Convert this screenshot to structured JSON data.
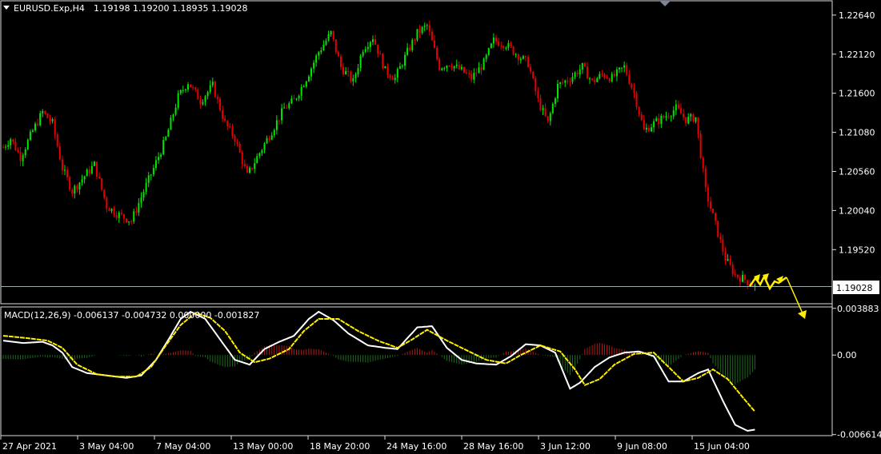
{
  "header": {
    "symbol": "EURUSD.Exp,H4",
    "ohlc": "1.19198 1.19200 1.18935 1.19028"
  },
  "macd_header": {
    "name": "MACD(12,26,9)",
    "values": "-0.006137 -0.004732 0.000000 -0.001827"
  },
  "price_scale": [
    "1.22640",
    "1.22120",
    "1.21600",
    "1.21080",
    "1.20560",
    "1.20040",
    "1.19520"
  ],
  "current_price": "1.19028",
  "macd_scale": [
    "0.003883",
    "0.00",
    "-0.006614"
  ],
  "time_axis": [
    "27 Apr 2021",
    "3 May 04:00",
    "7 May 04:00",
    "13 May 00:00",
    "18 May 20:00",
    "24 May 16:00",
    "28 May 16:00",
    "3 Jun 12:00",
    "9 Jun 08:00",
    "15 Jun 04:00"
  ],
  "colors": {
    "bull": "#00e600",
    "bear": "#e60000",
    "signal": "#ffee00",
    "macd": "#ffffff",
    "hist_pos": "#b01818",
    "hist_neg": "#1e6b1e",
    "arrow": "#ffee00"
  },
  "chart_data": [
    {
      "type": "candlestick",
      "title": "EURUSD.Exp,H4",
      "ylim": [
        1.188,
        1.2283
      ],
      "close_path": [
        [
          0,
          1.2088
        ],
        [
          3,
          1.21
        ],
        [
          7,
          1.2075
        ],
        [
          12,
          1.211
        ],
        [
          16,
          1.2135
        ],
        [
          20,
          1.212
        ],
        [
          24,
          1.206
        ],
        [
          28,
          1.203
        ],
        [
          33,
          1.205
        ],
        [
          37,
          1.2065
        ],
        [
          42,
          1.201
        ],
        [
          46,
          1.2
        ],
        [
          52,
          1.199
        ],
        [
          57,
          1.203
        ],
        [
          61,
          1.206
        ],
        [
          66,
          1.21
        ],
        [
          71,
          1.2155
        ],
        [
          75,
          1.2175
        ],
        [
          80,
          1.215
        ],
        [
          85,
          1.217
        ],
        [
          90,
          1.212
        ],
        [
          94,
          1.21
        ],
        [
          99,
          1.205
        ],
        [
          103,
          1.2075
        ],
        [
          109,
          1.211
        ],
        [
          114,
          1.214
        ],
        [
          118,
          1.215
        ],
        [
          123,
          1.218
        ],
        [
          128,
          1.2215
        ],
        [
          133,
          1.224
        ],
        [
          137,
          1.2195
        ],
        [
          142,
          1.2175
        ],
        [
          146,
          1.222
        ],
        [
          150,
          1.2235
        ],
        [
          155,
          1.219
        ],
        [
          159,
          1.218
        ],
        [
          164,
          1.2215
        ],
        [
          168,
          1.224
        ],
        [
          172,
          1.225
        ],
        [
          177,
          1.2195
        ],
        [
          181,
          1.22
        ],
        [
          186,
          1.219
        ],
        [
          190,
          1.218
        ],
        [
          195,
          1.22
        ],
        [
          199,
          1.223
        ],
        [
          204,
          1.2225
        ],
        [
          209,
          1.221
        ],
        [
          213,
          1.22
        ],
        [
          217,
          1.215
        ],
        [
          221,
          1.212
        ],
        [
          225,
          1.217
        ],
        [
          230,
          1.218
        ],
        [
          235,
          1.2195
        ],
        [
          239,
          1.2175
        ],
        [
          243,
          1.2185
        ],
        [
          247,
          1.218
        ],
        [
          252,
          1.2195
        ],
        [
          256,
          1.216
        ],
        [
          260,
          1.211
        ],
        [
          264,
          1.212
        ],
        [
          269,
          1.213
        ],
        [
          273,
          1.214
        ],
        [
          277,
          1.2125
        ],
        [
          281,
          1.2128
        ],
        [
          285,
          1.203
        ],
        [
          289,
          1.1985
        ],
        [
          293,
          1.194
        ],
        [
          297,
          1.1918
        ],
        [
          301,
          1.1912
        ],
        [
          305,
          1.1903
        ]
      ],
      "candle_count": 306
    },
    {
      "type": "line",
      "title": "MACD(12,26,9)",
      "ylim": [
        -0.0067,
        0.004
      ],
      "series": [
        {
          "name": "macd",
          "values": [
            [
              0,
              0.0012
            ],
            [
              8,
              0.001
            ],
            [
              16,
              0.0011
            ],
            [
              20,
              0.0008
            ],
            [
              24,
              0.0002
            ],
            [
              28,
              -0.001
            ],
            [
              34,
              -0.0015
            ],
            [
              42,
              -0.0017
            ],
            [
              50,
              -0.0019
            ],
            [
              56,
              -0.0017
            ],
            [
              62,
              -0.0004
            ],
            [
              68,
              0.0016
            ],
            [
              72,
              0.003
            ],
            [
              76,
              0.0036
            ],
            [
              82,
              0.003
            ],
            [
              88,
              0.0013
            ],
            [
              94,
              -0.0004
            ],
            [
              100,
              -0.0008
            ],
            [
              106,
              0.0005
            ],
            [
              112,
              0.0011
            ],
            [
              118,
              0.0016
            ],
            [
              124,
              0.003
            ],
            [
              128,
              0.0036
            ],
            [
              134,
              0.0029
            ],
            [
              140,
              0.0018
            ],
            [
              148,
              0.0008
            ],
            [
              155,
              0.0006
            ],
            [
              160,
              0.0005
            ],
            [
              168,
              0.0023
            ],
            [
              174,
              0.0024
            ],
            [
              180,
              0.0006
            ],
            [
              186,
              -0.0004
            ],
            [
              192,
              -0.0007
            ],
            [
              200,
              -0.0008
            ],
            [
              206,
              -0.0001
            ],
            [
              212,
              0.0009
            ],
            [
              218,
              0.0008
            ],
            [
              224,
              0.0002
            ],
            [
              230,
              -0.0028
            ],
            [
              234,
              -0.0023
            ],
            [
              240,
              -0.001
            ],
            [
              246,
              -0.0002
            ],
            [
              252,
              0.0002
            ],
            [
              258,
              0.0003
            ],
            [
              264,
              -0.0001
            ],
            [
              270,
              -0.0022
            ],
            [
              276,
              -0.0022
            ],
            [
              282,
              -0.0015
            ],
            [
              286,
              -0.0012
            ],
            [
              292,
              -0.0038
            ],
            [
              297,
              -0.0058
            ],
            [
              302,
              -0.0063
            ],
            [
              305,
              -0.0062
            ]
          ]
        },
        {
          "name": "signal",
          "values": [
            [
              0,
              0.0016
            ],
            [
              10,
              0.0014
            ],
            [
              18,
              0.0012
            ],
            [
              24,
              0.0006
            ],
            [
              30,
              -0.0008
            ],
            [
              38,
              -0.0016
            ],
            [
              46,
              -0.0018
            ],
            [
              54,
              -0.0018
            ],
            [
              60,
              -0.001
            ],
            [
              66,
              0.0008
            ],
            [
              72,
              0.0025
            ],
            [
              78,
              0.0035
            ],
            [
              84,
              0.0031
            ],
            [
              90,
              0.002
            ],
            [
              96,
              0.0002
            ],
            [
              102,
              -0.0006
            ],
            [
              108,
              -0.0003
            ],
            [
              116,
              0.0005
            ],
            [
              122,
              0.002
            ],
            [
              128,
              0.003
            ],
            [
              136,
              0.003
            ],
            [
              144,
              0.002
            ],
            [
              152,
              0.0012
            ],
            [
              160,
              0.0006
            ],
            [
              166,
              0.0013
            ],
            [
              172,
              0.0021
            ],
            [
              180,
              0.0012
            ],
            [
              188,
              0.0004
            ],
            [
              196,
              -0.0004
            ],
            [
              204,
              -0.0007
            ],
            [
              210,
              0.0
            ],
            [
              218,
              0.0008
            ],
            [
              226,
              0.0003
            ],
            [
              232,
              -0.0012
            ],
            [
              236,
              -0.0025
            ],
            [
              242,
              -0.002
            ],
            [
              248,
              -0.0008
            ],
            [
              256,
              0.0001
            ],
            [
              264,
              0.0002
            ],
            [
              270,
              -0.001
            ],
            [
              276,
              -0.0022
            ],
            [
              282,
              -0.0019
            ],
            [
              288,
              -0.0012
            ],
            [
              294,
              -0.002
            ],
            [
              300,
              -0.0035
            ],
            [
              305,
              -0.0047
            ]
          ]
        }
      ]
    }
  ]
}
